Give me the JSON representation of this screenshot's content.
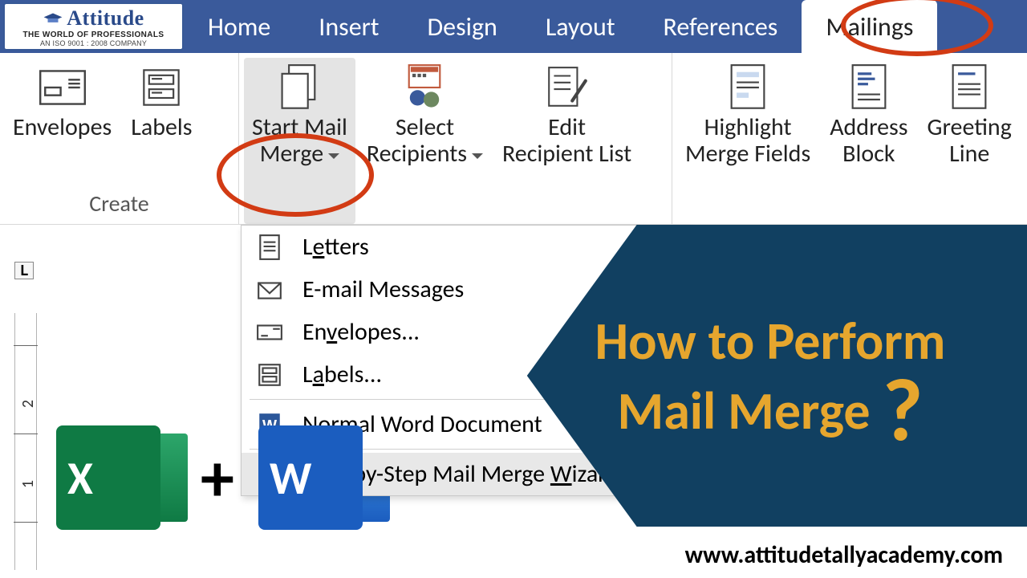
{
  "logo": {
    "title": "Attitude",
    "subtitle": "THE WORLD OF PROFESSIONALS",
    "iso": "AN ISO 9001 : 2008 COMPANY"
  },
  "tabs": {
    "home": "Home",
    "insert": "Insert",
    "design": "Design",
    "layout": "Layout",
    "references": "References",
    "mailings": "Mailings"
  },
  "ribbon": {
    "envelopes": "Envelopes",
    "labels": "Labels",
    "start_mail_merge_line1": "Start Mail",
    "start_mail_merge_line2": "Merge",
    "select_recipients_line1": "Select",
    "select_recipients_line2": "Recipients",
    "edit_recipient_line1": "Edit",
    "edit_recipient_line2": "Recipient List",
    "highlight_line1": "Highlight",
    "highlight_line2": "Merge Fields",
    "address_line1": "Address",
    "address_line2": "Block",
    "greeting_line1": "Greeting",
    "greeting_line2": "Line",
    "group_create": "Create"
  },
  "menu": {
    "letters_pre": "L",
    "letters_u": "e",
    "letters_post": "tters",
    "email": "E-mail Messages",
    "envelopes_pre": "En",
    "envelopes_u": "v",
    "envelopes_post": "elopes...",
    "labels_pre": "L",
    "labels_u": "a",
    "labels_post": "bels...",
    "normal_pre": "",
    "normal_u": "N",
    "normal_post": "ormal Word Document",
    "wizard_pre": "Step-by-Step Mail Merge ",
    "wizard_u": "W",
    "wizard_post": "izard..."
  },
  "ruler": {
    "corner": "L",
    "mark1": "1",
    "mark2": "2"
  },
  "banner": {
    "line1": "How to Perform",
    "line2": "Mail Merge",
    "q": "?"
  },
  "apps": {
    "excel": "X",
    "plus": "+",
    "word": "W"
  },
  "url": "www.attitudetallyacademy.com"
}
